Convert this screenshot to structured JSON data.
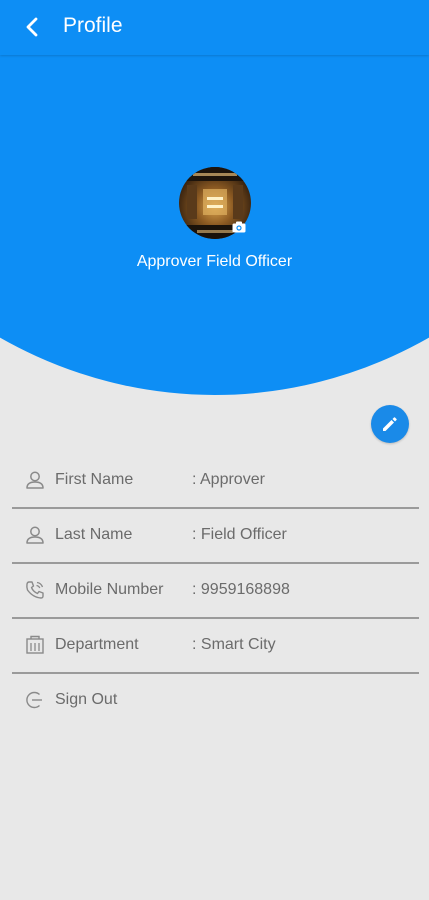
{
  "appbar": {
    "title": "Profile"
  },
  "profile": {
    "name": "Approver Field Officer"
  },
  "details": [
    {
      "label": "First Name",
      "value": ": Approver"
    },
    {
      "label": "Last Name",
      "value": ": Field Officer"
    },
    {
      "label": "Mobile Number",
      "value": ": 9959168898"
    },
    {
      "label": "Department",
      "value": ": Smart City"
    }
  ],
  "signout": {
    "label": "Sign Out"
  },
  "icons": {
    "back": "arrow-back-icon",
    "camera": "camera-icon",
    "edit": "pencil-icon",
    "first_name": "person-icon",
    "last_name": "person-icon",
    "mobile": "phone-icon",
    "department": "building-icon",
    "signout": "logout-icon"
  },
  "colors": {
    "primary": "#0d8ef5",
    "background": "#e8e8e8",
    "text": "#6b6b6b"
  }
}
